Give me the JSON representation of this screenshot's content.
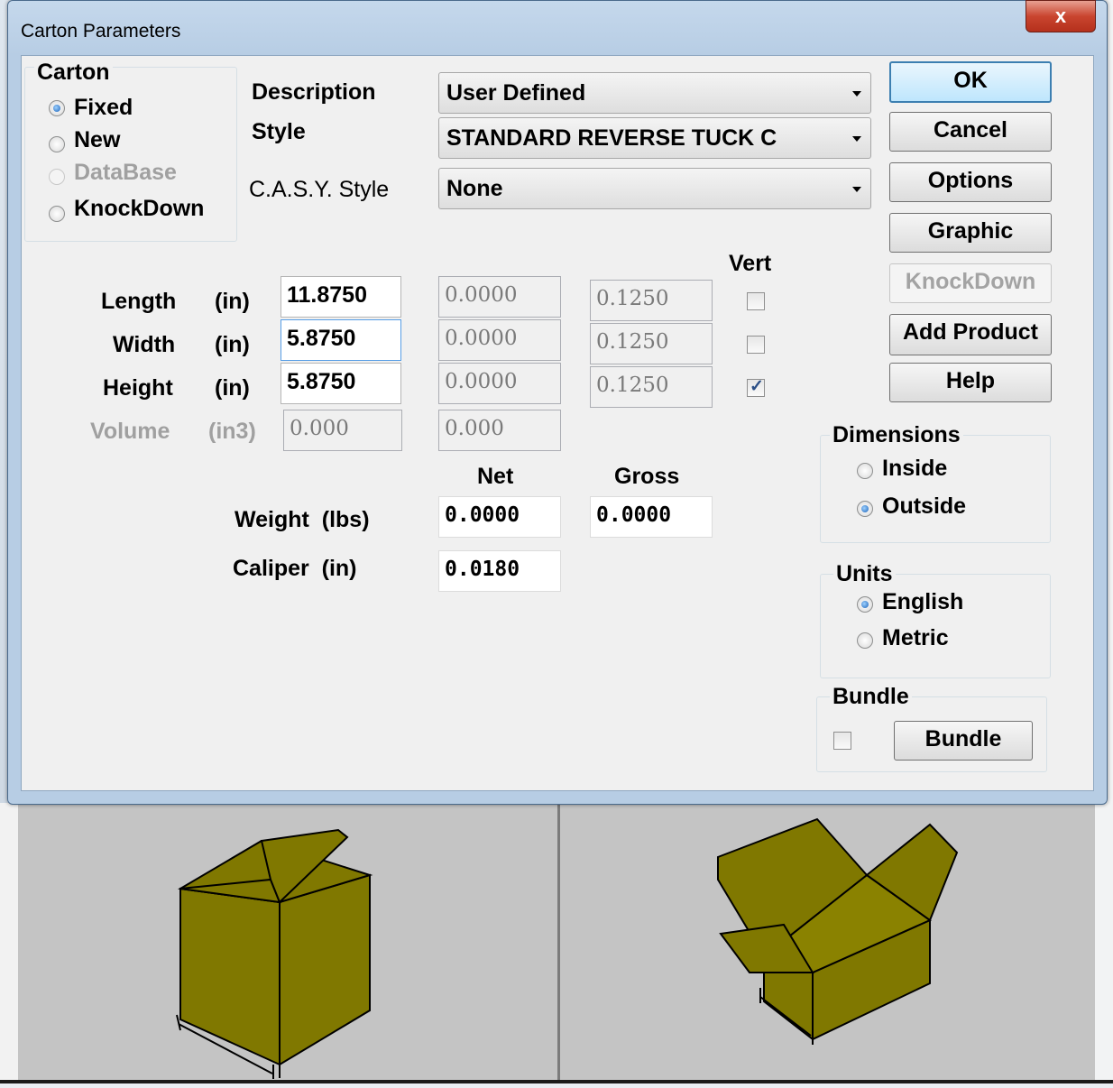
{
  "window": {
    "title": "Carton Parameters",
    "close_glyph": "x"
  },
  "carton_group": {
    "title": "Carton",
    "options": [
      {
        "label": "Fixed",
        "selected": true,
        "enabled": true
      },
      {
        "label": "New",
        "selected": false,
        "enabled": true
      },
      {
        "label": "DataBase",
        "selected": false,
        "enabled": false
      },
      {
        "label": "KnockDown",
        "selected": false,
        "enabled": true
      }
    ]
  },
  "fields": {
    "description_label": "Description",
    "description_value": "User Defined",
    "style_label": "Style",
    "style_value": "STANDARD REVERSE TUCK C",
    "casy_label": "C.A.S.Y. Style",
    "casy_value": "None"
  },
  "dims": {
    "vert_label": "Vert",
    "rows": [
      {
        "label": "Length",
        "unit": "(in)",
        "value": "11.8750",
        "v2": "0.0000",
        "v3": "0.1250",
        "vert": false
      },
      {
        "label": "Width",
        "unit": "(in)",
        "value": "5.8750",
        "v2": "0.0000",
        "v3": "0.1250",
        "vert": false
      },
      {
        "label": "Height",
        "unit": "(in)",
        "value": "5.8750",
        "v2": "0.0000",
        "v3": "0.1250",
        "vert": true
      }
    ],
    "volume": {
      "label": "Volume",
      "unit": "(in3)",
      "v1": "0.000",
      "v2": "0.000"
    }
  },
  "weights": {
    "net_label": "Net",
    "gross_label": "Gross",
    "weight_label": "Weight  (lbs)",
    "net_value": "0.0000",
    "gross_value": "0.0000",
    "caliper_label": "Caliper  (in)",
    "caliper_value": "0.0180"
  },
  "buttons": {
    "ok": "OK",
    "cancel": "Cancel",
    "options": "Options",
    "graphic": "Graphic",
    "knockdown": "KnockDown",
    "add_product": "Add Product",
    "help": "Help"
  },
  "dimensions_group": {
    "title": "Dimensions",
    "inside": "Inside",
    "outside": "Outside",
    "selected": "Outside"
  },
  "units_group": {
    "title": "Units",
    "english": "English",
    "metric": "Metric",
    "selected": "English"
  },
  "bundle_group": {
    "title": "Bundle",
    "checked": false,
    "button": "Bundle"
  },
  "colors": {
    "carton_fill": "#807800",
    "pane_background": "#c4c4c4"
  }
}
